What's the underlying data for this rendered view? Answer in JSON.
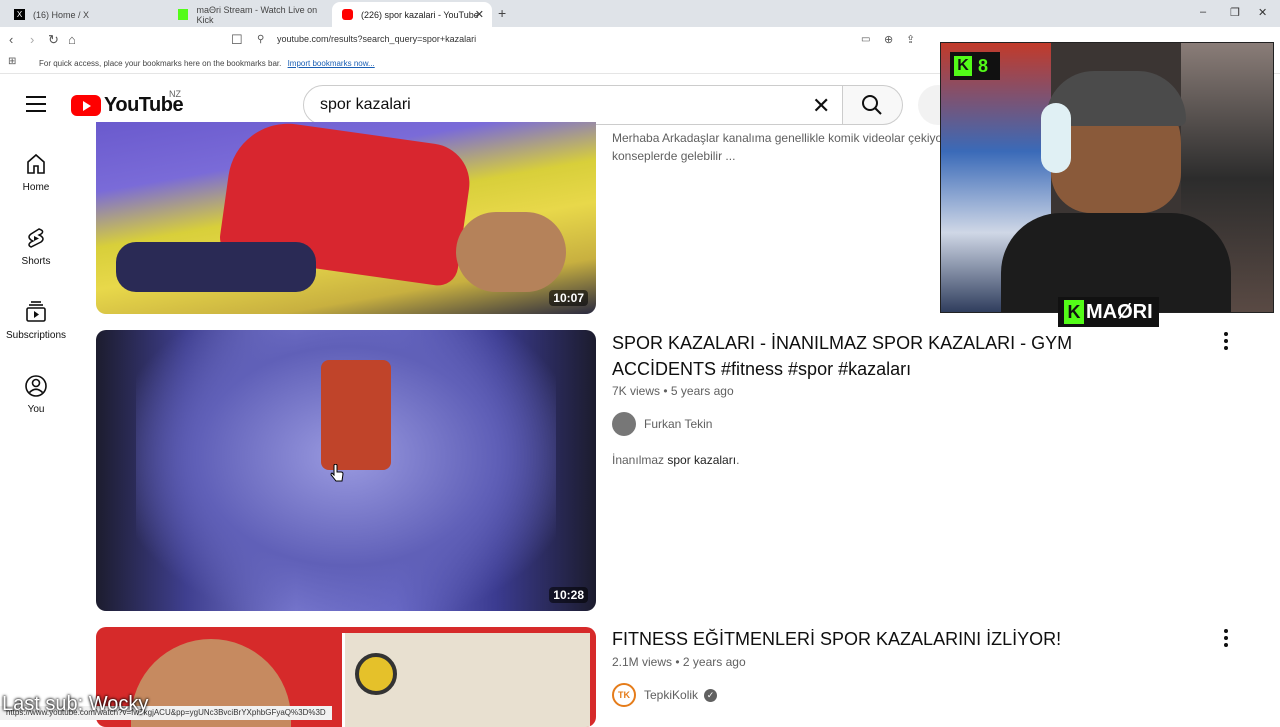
{
  "browser": {
    "tabs": [
      {
        "label": "(16) Home / X",
        "icon": "x-logo-icon"
      },
      {
        "label": "maΘri Stream - Watch Live on Kick",
        "icon": "kick-logo-icon"
      },
      {
        "label": "(226) spor kazalari - YouTube",
        "icon": "youtube-logo-icon",
        "active": true
      }
    ],
    "new_tab": "+",
    "url": "youtube.com/results?search_query=spor+kazalari",
    "bookmarks_hint": "For quick access, place your bookmarks here on the bookmarks bar.",
    "bookmarks_link": "Import bookmarks now...",
    "status_url": "https://www.youtube.com/watch?v=fw7kgjACU&pp=ygUNc3BvciBrYXphbGFyaQ%3D%3D"
  },
  "youtube": {
    "logo_text": "YouTube",
    "country": "NZ",
    "search_value": "spor kazalari",
    "sidebar": [
      {
        "label": "Home",
        "icon": "home-icon"
      },
      {
        "label": "Shorts",
        "icon": "shorts-icon"
      },
      {
        "label": "Subscriptions",
        "icon": "subscriptions-icon"
      },
      {
        "label": "You",
        "icon": "you-icon"
      }
    ],
    "results": [
      {
        "duration": "10:07",
        "desc": "Merhaba Arkadaşlar kanalıma genellikle komik videolar çekiyo",
        "desc2": "konseplerde gelebilir ..."
      },
      {
        "title": "SPOR KAZALARI - İNANILMAZ SPOR KAZALARI - GYM ACCİDENTS #fitness #spor #kazaları",
        "views": "7K views",
        "age": "5 years ago",
        "channel": "Furkan Tekin",
        "desc_pre": "İnanılmaz ",
        "desc_bold": "spor kazaları",
        "desc_post": ".",
        "duration": "10:28"
      },
      {
        "title": "FITNESS EĞİTMENLERİ SPOR KAZALARINI İZLİYOR!",
        "views": "2.1M views",
        "age": "2 years ago",
        "channel": "TepkiKolik",
        "channel_avatar_text": "TK"
      }
    ]
  },
  "overlay": {
    "kick_viewers": "8",
    "kick_letter": "K",
    "streamer_logo": "MAØRI",
    "last_sub": "Last sub: Wocky"
  },
  "colors": {
    "youtube_red": "#ff0000",
    "kick_green": "#53fc18"
  }
}
